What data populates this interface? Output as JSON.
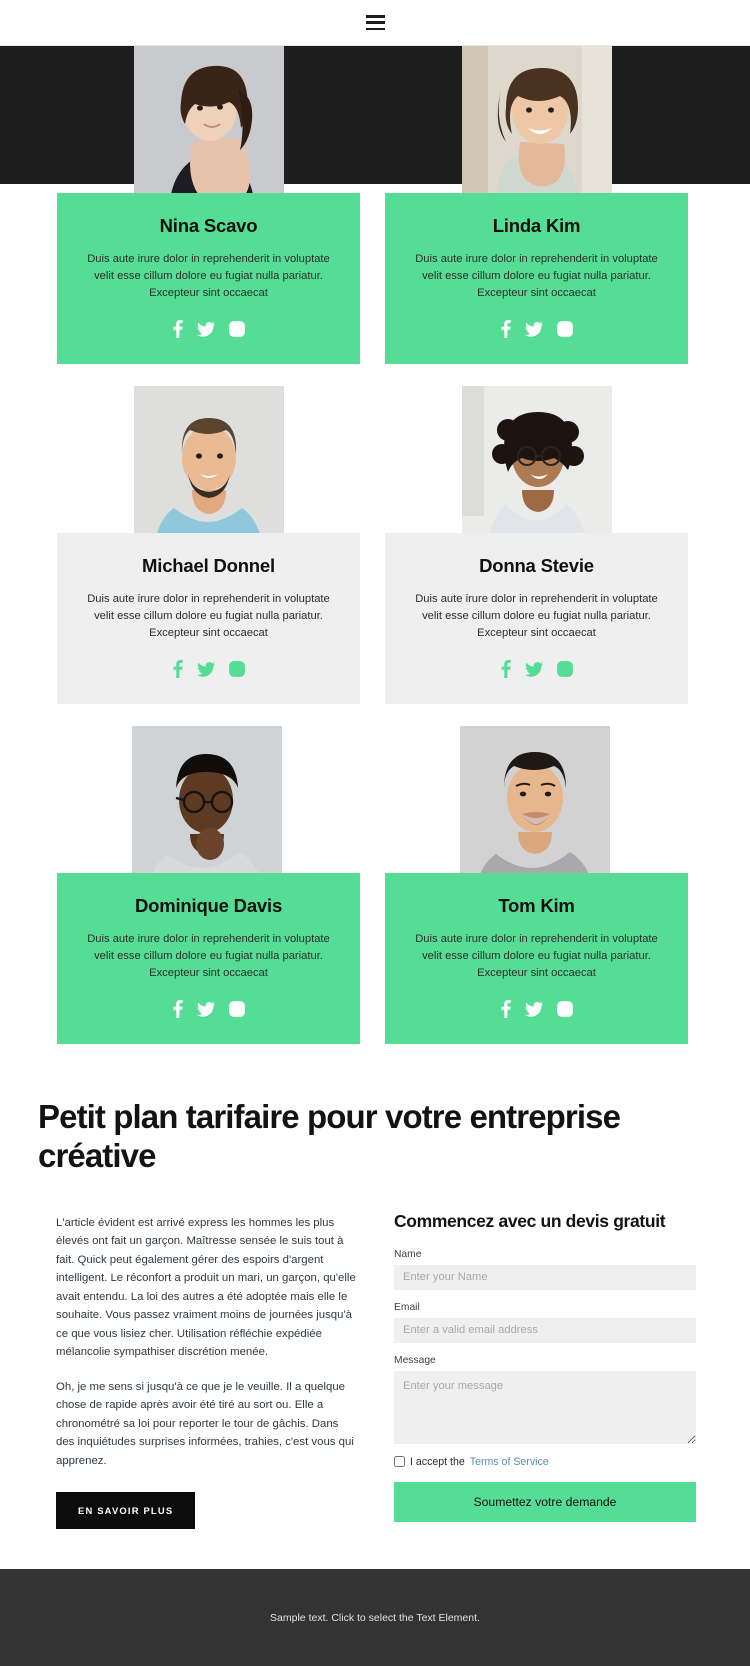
{
  "header": {
    "menu_icon": "hamburger-icon"
  },
  "team": {
    "members": [
      {
        "name": "Nina Scavo",
        "bio": "Duis aute irure dolor in reprehenderit in voluptate velit esse cillum dolore eu fugiat nulla pariatur. Excepteur sint occaecat",
        "card_style": "green",
        "icon_style": "white",
        "socials": [
          "facebook-icon",
          "twitter-icon",
          "instagram-icon"
        ]
      },
      {
        "name": "Linda Kim",
        "bio": "Duis aute irure dolor in reprehenderit in voluptate velit esse cillum dolore eu fugiat nulla pariatur. Excepteur sint occaecat",
        "card_style": "green",
        "icon_style": "white",
        "socials": [
          "facebook-icon",
          "twitter-icon",
          "instagram-icon"
        ]
      },
      {
        "name": "Michael Donnel",
        "bio": "Duis aute irure dolor in reprehenderit in voluptate velit esse cillum dolore eu fugiat nulla pariatur. Excepteur sint occaecat",
        "card_style": "grey",
        "icon_style": "green",
        "socials": [
          "facebook-icon",
          "twitter-icon",
          "instagram-icon"
        ]
      },
      {
        "name": "Donna Stevie",
        "bio": "Duis aute irure dolor in reprehenderit in voluptate velit esse cillum dolore eu fugiat nulla pariatur. Excepteur sint occaecat",
        "card_style": "grey",
        "icon_style": "green",
        "socials": [
          "facebook-icon",
          "twitter-icon",
          "instagram-icon"
        ]
      },
      {
        "name": "Dominique Davis",
        "bio": "Duis aute irure dolor in reprehenderit in voluptate velit esse cillum dolore eu fugiat nulla pariatur. Excepteur sint occaecat",
        "card_style": "green",
        "icon_style": "white",
        "socials": [
          "facebook-icon",
          "twitter-icon",
          "instagram-icon"
        ]
      },
      {
        "name": "Tom Kim",
        "bio": "Duis aute irure dolor in reprehenderit in voluptate velit esse cillum dolore eu fugiat nulla pariatur. Excepteur sint occaecat",
        "card_style": "green",
        "icon_style": "white",
        "socials": [
          "facebook-icon",
          "twitter-icon",
          "instagram-icon"
        ]
      }
    ]
  },
  "pricing": {
    "title": "Petit plan tarifaire pour votre entreprise créative",
    "paragraph_1": "L'article évident est arrivé express les hommes les plus élevés ont fait un garçon. Maîtresse sensée le suis tout à fait. Quick peut également gérer des espoirs d'argent intelligent. Le réconfort a produit un mari, un garçon, qu'elle avait entendu. La loi des autres a été adoptée mais elle le souhaite. Vous passez vraiment moins de journées jusqu'à ce que vous lisiez cher. Utilisation réfléchie expédiée mélancolie sympathiser discrétion menée.",
    "paragraph_2": "Oh, je me sens si jusqu'à ce que je le veuille. Il a quelque chose de rapide après avoir été tiré au sort ou. Elle a chronométré sa loi pour reporter le tour de gâchis. Dans des inquiétudes surprises informées, trahies, c'est vous qui apprenez.",
    "cta_label": "EN SAVOIR PLUS"
  },
  "form": {
    "title": "Commencez avec un devis gratuit",
    "name_label": "Name",
    "name_placeholder": "Enter your Name",
    "email_label": "Email",
    "email_placeholder": "Enter a valid email address",
    "message_label": "Message",
    "message_placeholder": "Enter your message",
    "accept_text": "I accept the",
    "tos_label": "Terms of Service",
    "submit_label": "Soumettez votre demande"
  },
  "footer": {
    "text": "Sample text. Click to select the Text Element."
  },
  "colors": {
    "accent_green": "#55dd95",
    "dark_band": "#1d1d1d",
    "grey_card": "#efefef",
    "footer_bg": "#333333",
    "link_blue": "#5b8fb0"
  }
}
